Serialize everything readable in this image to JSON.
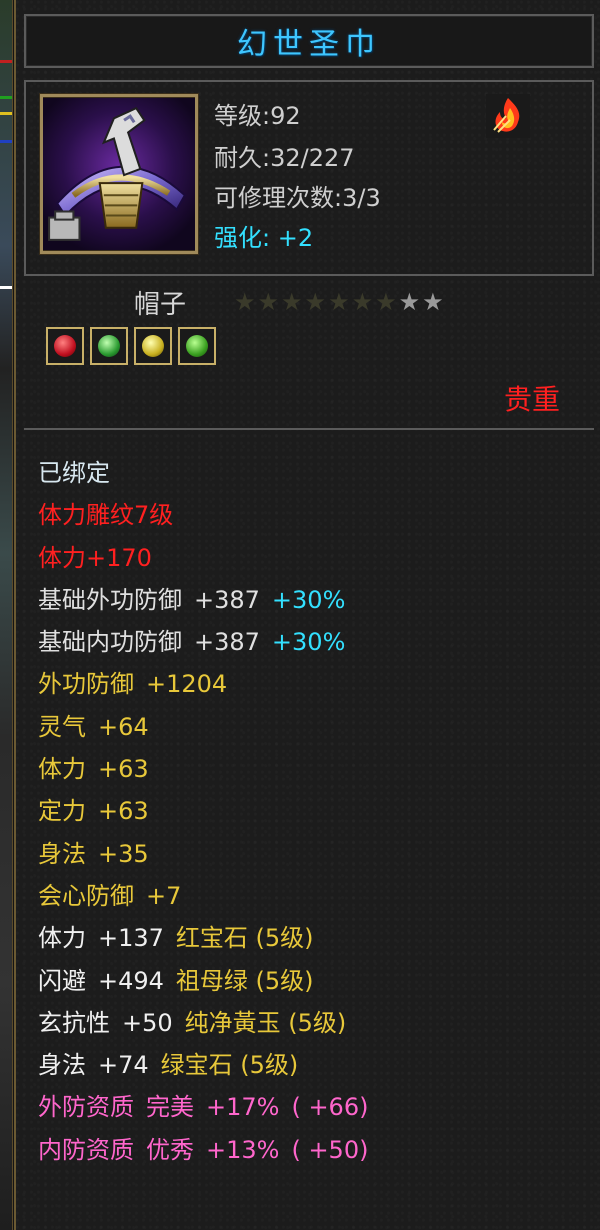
{
  "title": "幻世圣巾",
  "icon": {
    "name": "helmet-item-icon"
  },
  "level": "等级:92",
  "durability": "耐久:32/227",
  "repairs": "可修理次数:3/3",
  "enhance": "强化: +2",
  "item_type": "帽子",
  "stars": {
    "filled": 7,
    "total": 9,
    "filled_color": "#3a3a2a",
    "empty_color": "#9a9a9a"
  },
  "gems": [
    "red-gem-icon",
    "green-gem-icon",
    "yellow-gem-icon",
    "green-gem-icon"
  ],
  "rarity": "贵重",
  "attributes": [
    {
      "parts": [
        "已绑定"
      ],
      "colors": [
        "#d8e8f0"
      ]
    },
    {
      "parts": [
        "体力雕纹7级"
      ],
      "colors": [
        "#ff2020"
      ]
    },
    {
      "parts": [
        "体力+170"
      ],
      "colors": [
        "#ff2020"
      ]
    },
    {
      "parts": [
        "基础外功防御",
        "+387",
        "+30%"
      ],
      "colors": [
        "#e0e0e0",
        "#e0e0e0",
        "#33e0ff"
      ]
    },
    {
      "parts": [
        "基础内功防御",
        "+387",
        "+30%"
      ],
      "colors": [
        "#e0e0e0",
        "#e0e0e0",
        "#33e0ff"
      ]
    },
    {
      "parts": [
        "外功防御",
        "+1204"
      ],
      "colors": [
        "#e8c83a",
        "#e8c83a"
      ]
    },
    {
      "parts": [
        "灵气",
        "+64"
      ],
      "colors": [
        "#e8c83a",
        "#e8c83a"
      ]
    },
    {
      "parts": [
        "体力",
        "+63"
      ],
      "colors": [
        "#e8c83a",
        "#e8c83a"
      ]
    },
    {
      "parts": [
        "定力",
        "+63"
      ],
      "colors": [
        "#e8c83a",
        "#e8c83a"
      ]
    },
    {
      "parts": [
        "身法",
        "+35"
      ],
      "colors": [
        "#e8c83a",
        "#e8c83a"
      ]
    },
    {
      "parts": [
        "会心防御",
        "+7"
      ],
      "colors": [
        "#e8c83a",
        "#e8c83a"
      ]
    },
    {
      "parts": [
        "体力",
        "+137",
        "红宝石 (5级)"
      ],
      "colors": [
        "#f0f0f0",
        "#f0f0f0",
        "#e8c83a"
      ]
    },
    {
      "parts": [
        "闪避",
        "+494",
        "祖母绿 (5级)"
      ],
      "colors": [
        "#f0f0f0",
        "#f0f0f0",
        "#e8c83a"
      ]
    },
    {
      "parts": [
        "玄抗性",
        "+50",
        "纯净黃玉 (5级)"
      ],
      "colors": [
        "#f0f0f0",
        "#f0f0f0",
        "#e8c83a"
      ]
    },
    {
      "parts": [
        "身法",
        "+74",
        "绿宝石 (5级)"
      ],
      "colors": [
        "#f0f0f0",
        "#f0f0f0",
        "#e8c83a"
      ]
    },
    {
      "parts": [
        "外防资质",
        "完美",
        "+17%",
        "( +66)"
      ],
      "colors": [
        "#ff66cc",
        "#ff66cc",
        "#ff66cc",
        "#ff66cc"
      ]
    },
    {
      "parts": [
        "内防资质",
        "优秀",
        "+13%",
        "( +50)"
      ],
      "colors": [
        "#ff66cc",
        "#ff66cc",
        "#ff66cc",
        "#ff66cc"
      ]
    }
  ],
  "colors": {
    "title": "#3ec6ff",
    "enhance": "#33e0ff",
    "rarity": "#ff2020",
    "frame": "#5b5b5b"
  }
}
